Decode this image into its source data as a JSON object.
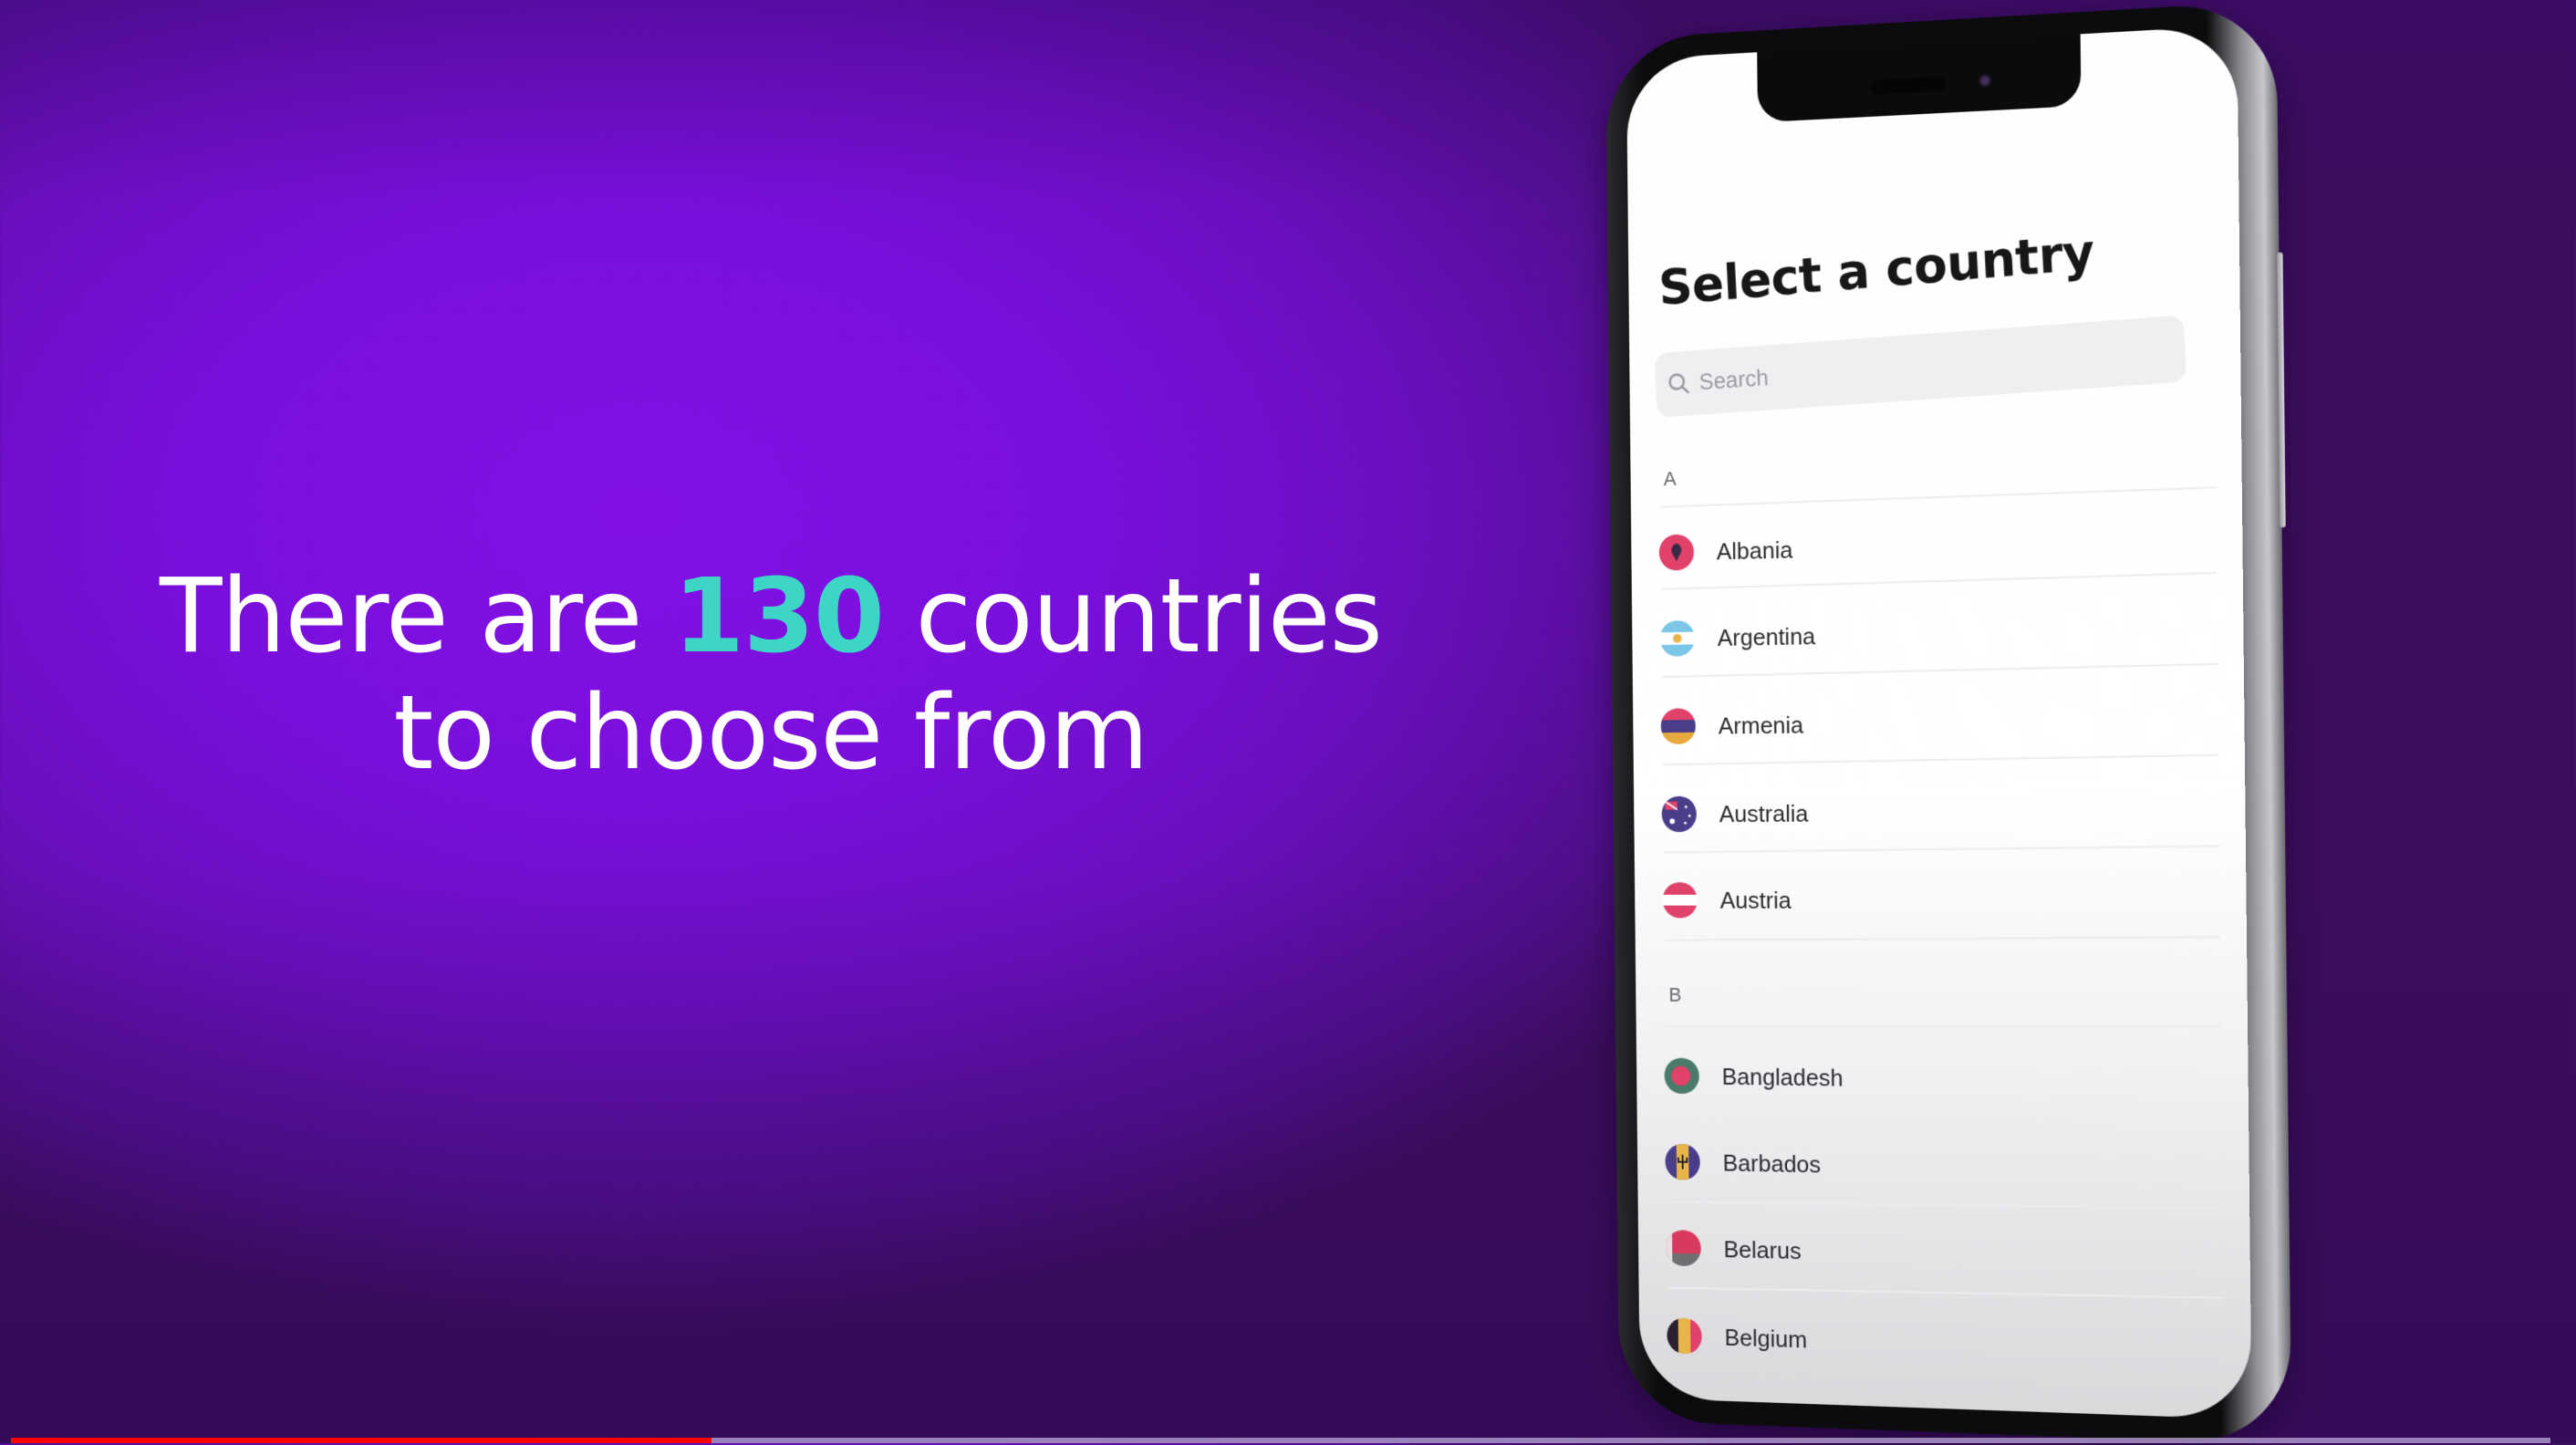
{
  "headline": {
    "before": "There are ",
    "highlight": "130",
    "after": " countries",
    "line2": "to choose from"
  },
  "colors": {
    "background": "#7e10e0",
    "accent": "#3dd6c6",
    "headline_text": "#ffffff",
    "progress": "#ff0000"
  },
  "phone": {
    "title": "Select a country",
    "search": {
      "placeholder": "Search",
      "icon": "search-icon"
    },
    "sections": [
      {
        "letter": "A",
        "countries": [
          {
            "name": "Albania",
            "flag": "albania-flag-icon"
          },
          {
            "name": "Argentina",
            "flag": "argentina-flag-icon"
          },
          {
            "name": "Armenia",
            "flag": "armenia-flag-icon"
          },
          {
            "name": "Australia",
            "flag": "australia-flag-icon"
          },
          {
            "name": "Austria",
            "flag": "austria-flag-icon"
          }
        ]
      },
      {
        "letter": "B",
        "countries": [
          {
            "name": "Bangladesh",
            "flag": "bangladesh-flag-icon"
          },
          {
            "name": "Barbados",
            "flag": "barbados-flag-icon"
          },
          {
            "name": "Belarus",
            "flag": "belarus-flag-icon"
          },
          {
            "name": "Belgium",
            "flag": "belgium-flag-icon"
          }
        ]
      }
    ]
  },
  "video": {
    "progress_percent": 27.6
  }
}
